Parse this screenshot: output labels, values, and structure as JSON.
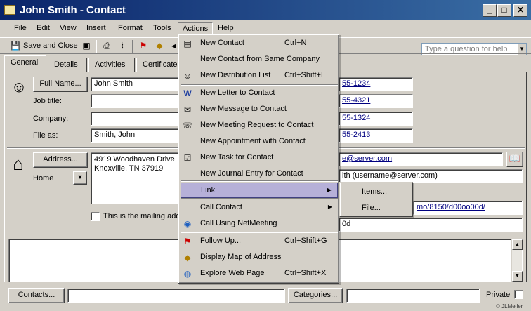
{
  "window": {
    "title": "John Smith - Contact",
    "controls": [
      "minimize-icon",
      "maximize-icon",
      "close-icon"
    ]
  },
  "menubar": {
    "items": [
      "File",
      "Edit",
      "View",
      "Insert",
      "Format",
      "Tools",
      "Actions",
      "Help"
    ],
    "active": "Actions",
    "help_placeholder": "Type a question for help"
  },
  "toolbar": {
    "save_close_label": "Save and Close",
    "icons": [
      "save-icon",
      "save-new-icon",
      "print-icon",
      "attach-icon",
      "follow-up-flag-icon",
      "map-icon",
      "previous-item-icon",
      "next-item-icon"
    ]
  },
  "tabs": [
    "General",
    "Details",
    "Activities",
    "Certificates"
  ],
  "selected_tab": "General",
  "form": {
    "full_name_button": "Full Name...",
    "full_name_value": "John Smith",
    "job_title_label": "Job title:",
    "company_label": "Company:",
    "file_as_label": "File as:",
    "file_as_value": "Smith, John",
    "address_button": "Address...",
    "address_type": "Home",
    "address_line1": "4919 Woodhaven Drive",
    "address_line2": "Knoxville, TN  37919",
    "mailing_checkbox_label": "This is the mailing addr",
    "phones": [
      "55-1234",
      "55-4321",
      "55-1324",
      "55-2413"
    ],
    "email": "e@server.com",
    "display_as": "ith (username@server.com)",
    "web": "mo/8150/d00oo00d/",
    "im": "0d",
    "contacts_button": "Contacts...",
    "categories_button": "Categories...",
    "private_label": "Private",
    "watermark": "© JLMeller"
  },
  "actions_menu": {
    "items": [
      {
        "label": "New Contact",
        "shortcut": "Ctrl+N",
        "icon": "new-contact-icon"
      },
      {
        "label": "New Contact from Same Company",
        "shortcut": "",
        "icon": ""
      },
      {
        "label": "New Distribution List",
        "shortcut": "Ctrl+Shift+L",
        "icon": "distribution-list-icon"
      },
      {
        "label": "New Letter to Contact",
        "shortcut": "",
        "icon": "word-letter-icon"
      },
      {
        "label": "New Message to Contact",
        "shortcut": "",
        "icon": "new-message-icon"
      },
      {
        "label": "New Meeting Request to Contact",
        "shortcut": "",
        "icon": "meeting-request-icon"
      },
      {
        "label": "New Appointment with Contact",
        "shortcut": "",
        "icon": ""
      },
      {
        "label": "New Task for Contact",
        "shortcut": "",
        "icon": "task-icon"
      },
      {
        "label": "New Journal Entry for Contact",
        "shortcut": "",
        "icon": ""
      },
      {
        "label": "Link",
        "shortcut": "",
        "icon": "",
        "submenu": true,
        "highlighted": true
      },
      {
        "label": "Call Contact",
        "shortcut": "",
        "icon": "",
        "submenu": true
      },
      {
        "label": "Call Using NetMeeting",
        "shortcut": "",
        "icon": "netmeeting-icon"
      },
      {
        "label": "Follow Up...",
        "shortcut": "Ctrl+Shift+G",
        "icon": "follow-up-flag-icon"
      },
      {
        "label": "Display Map of Address",
        "shortcut": "",
        "icon": "map-icon"
      },
      {
        "label": "Explore Web Page",
        "shortcut": "Ctrl+Shift+X",
        "icon": "web-page-icon"
      }
    ]
  },
  "link_submenu": {
    "items": [
      "Items...",
      "File..."
    ]
  }
}
